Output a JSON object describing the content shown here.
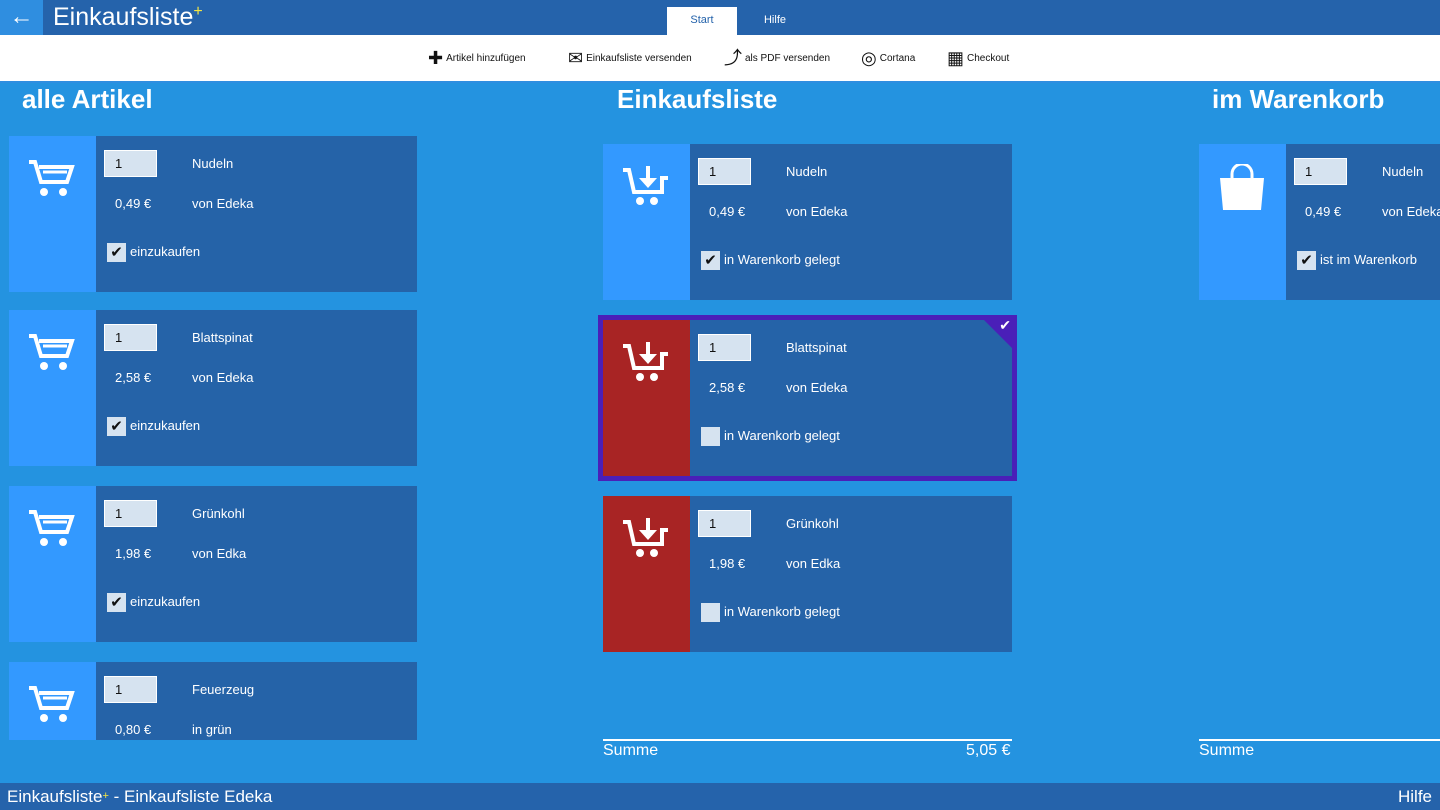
{
  "header": {
    "title": "Einkaufsliste",
    "title_star": "+",
    "tabs": [
      {
        "label": "Start"
      },
      {
        "label": "Hilfe"
      }
    ]
  },
  "toolbar": [
    {
      "label": "Artikel hinzufügen",
      "icon": "plus-icon"
    },
    {
      "label": "Einkaufsliste versenden",
      "icon": "mail-icon"
    },
    {
      "label": "als PDF versenden",
      "icon": "pdf-icon"
    },
    {
      "label": "Cortana",
      "icon": "cortana-icon"
    },
    {
      "label": "Checkout",
      "icon": "cash-register-icon"
    }
  ],
  "columns": {
    "all": {
      "title": "alle Artikel",
      "items": [
        {
          "qty": "1",
          "name": "Nudeln",
          "price": "0,49 €",
          "shop": "von Edeka",
          "check": "einzukaufen",
          "checked": true
        },
        {
          "qty": "1",
          "name": "Blattspinat",
          "price": "2,58 €",
          "shop": "von Edeka",
          "check": "einzukaufen",
          "checked": true
        },
        {
          "qty": "1",
          "name": "Grünkohl",
          "price": "1,98 €",
          "shop": "von Edka",
          "check": "einzukaufen",
          "checked": true
        },
        {
          "qty": "1",
          "name": "Feuerzeug",
          "price": "0,80 €",
          "shop": "in grün",
          "check": "",
          "checked": false
        }
      ]
    },
    "list": {
      "title": "Einkaufsliste",
      "items": [
        {
          "qty": "1",
          "name": "Nudeln",
          "price": "0,49 €",
          "shop": "von Edeka",
          "check": "in Warenkorb gelegt",
          "checked": true,
          "state": "in-cart"
        },
        {
          "qty": "1",
          "name": "Blattspinat",
          "price": "2,58 €",
          "shop": "von Edeka",
          "check": "in Warenkorb gelegt",
          "checked": false,
          "state": "open",
          "selected": true
        },
        {
          "qty": "1",
          "name": "Grünkohl",
          "price": "1,98 €",
          "shop": "von Edka",
          "check": "in Warenkorb gelegt",
          "checked": false,
          "state": "open"
        }
      ],
      "sum_label": "Summe",
      "sum_value": "5,05 €"
    },
    "cart": {
      "title": "im Warenkorb",
      "items": [
        {
          "qty": "1",
          "name": "Nudeln",
          "price": "0,49 €",
          "shop": "von Edeka",
          "check": "ist im Warenkorb",
          "checked": true
        }
      ],
      "sum_label": "Summe"
    }
  },
  "footer": {
    "app": "Einkaufsliste",
    "star": "+",
    "subtitle": " - Einkaufsliste Edeka",
    "help": "Hilfe"
  },
  "colors": {
    "header": "#2563ab",
    "background": "#2493e0",
    "card": "#2563a8",
    "icon_light": "#3399ff",
    "icon_red": "#a82424",
    "selection": "#4a1fb8"
  }
}
